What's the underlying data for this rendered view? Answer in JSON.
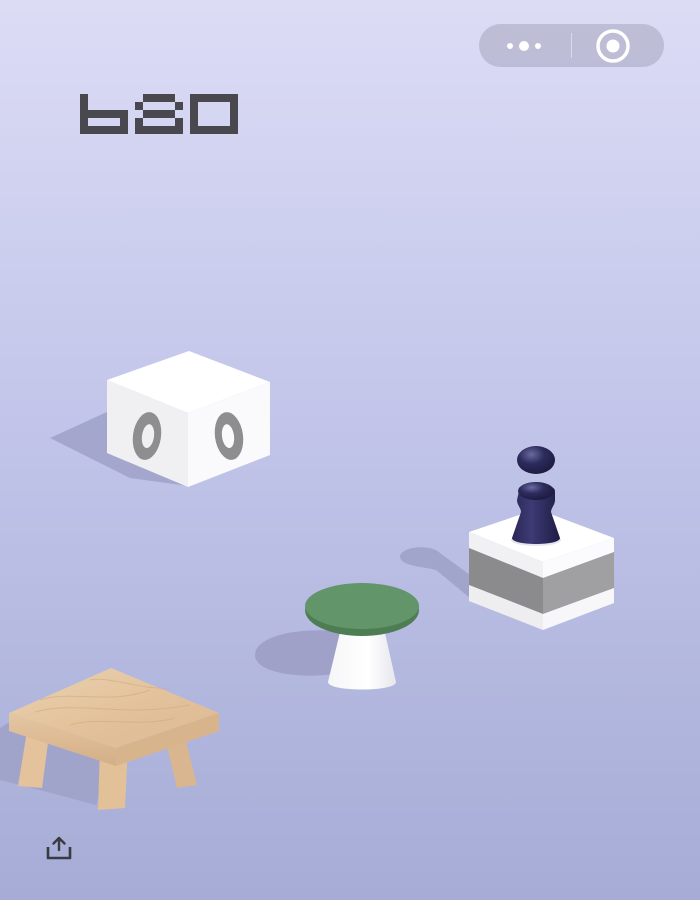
{
  "game": {
    "score": "680"
  },
  "topbar": {
    "more_icon": "more-dots-icon",
    "close_icon": "target-close-icon"
  },
  "scene": {
    "platforms": [
      "white-cube-platform",
      "green-round-table-platform",
      "striped-box-platform",
      "wooden-stool-platform"
    ],
    "player": "dark-chess-piece-player"
  },
  "footer": {
    "share_icon": "share-upload-icon"
  },
  "colors": {
    "background_top": "#dcdcf5",
    "background_bottom": "#a6acd6",
    "score": "#48484e",
    "player": "#2a2855",
    "table_top": "#5f9163",
    "wood": "#e6c9a5",
    "cube_face": "#ffffff"
  }
}
